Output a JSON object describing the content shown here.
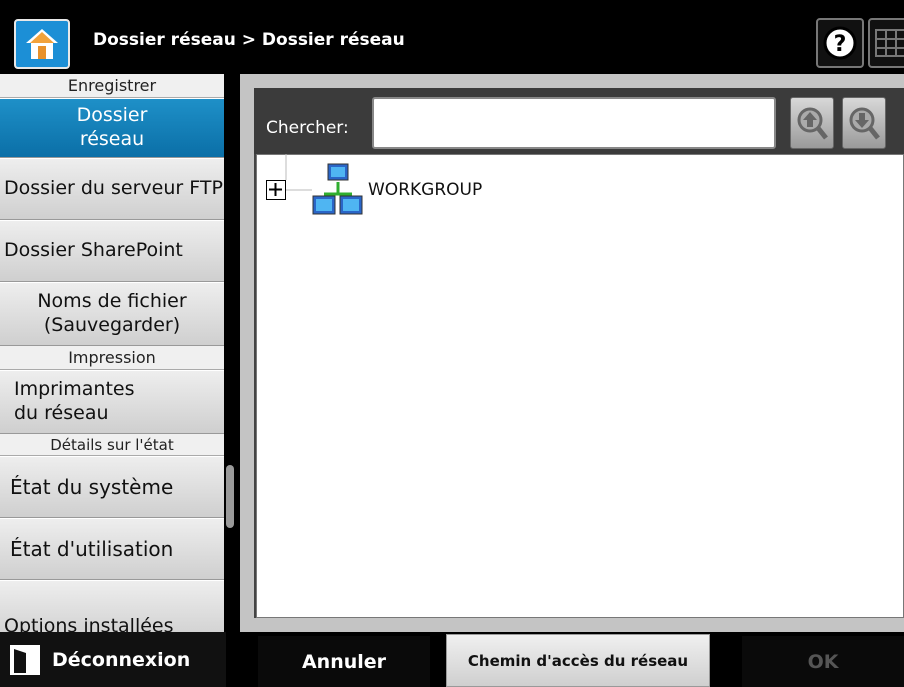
{
  "header": {
    "breadcrumb": "Dossier réseau > Dossier réseau",
    "help_label": "?"
  },
  "sidebar": {
    "section_save": "Enregistrer",
    "items_save": [
      {
        "label": "Dossier\nréseau",
        "selected": true
      },
      {
        "label": "Dossier du serveur FTP"
      },
      {
        "label": "Dossier SharePoint"
      },
      {
        "label": "Noms de fichier (Sauvegarder)"
      }
    ],
    "section_print": "Impression",
    "items_print": [
      {
        "label": "Imprimantes du réseau"
      }
    ],
    "section_status": "Détails sur l'état",
    "items_status": [
      {
        "label": "État du système"
      },
      {
        "label": "État d'utilisation"
      },
      {
        "label": "Options installées"
      }
    ]
  },
  "search": {
    "label": "Chercher:",
    "value": "",
    "placeholder": ""
  },
  "tree": {
    "nodes": [
      {
        "label": "WORKGROUP",
        "expanded": false
      }
    ]
  },
  "footer": {
    "logout_label": "Déconnexion",
    "cancel_label": "Annuler",
    "path_label": "Chemin d'accès du réseau",
    "ok_label": "OK"
  },
  "colors": {
    "accent_blue": "#1c8fd6",
    "selected_item": "#0b6fa7"
  }
}
